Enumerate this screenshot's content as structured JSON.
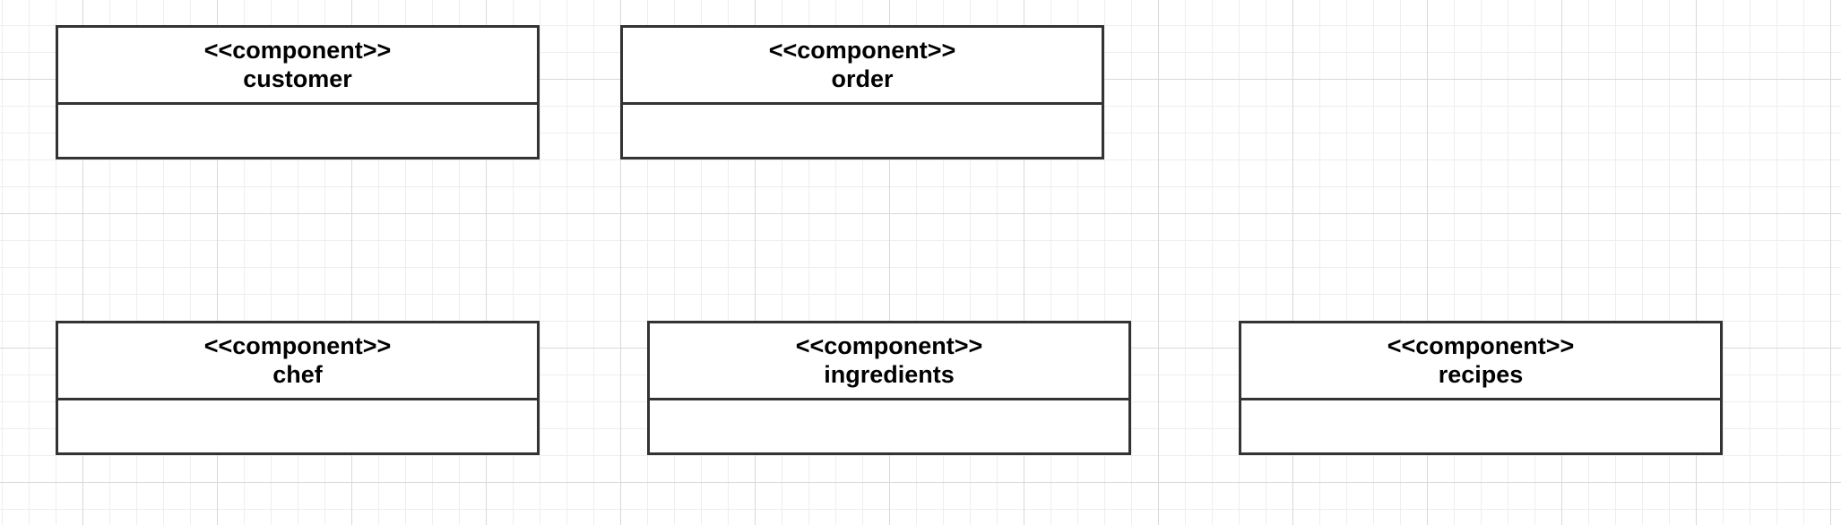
{
  "canvas": {
    "background": "#ffffff",
    "grid_major_color": "#d9d9d9",
    "grid_minor_color": "#eeeeee",
    "border_color": "#333333"
  },
  "components": [
    {
      "stereotype": "<<component>>",
      "name": "customer"
    },
    {
      "stereotype": "<<component>>",
      "name": "order"
    },
    {
      "stereotype": "<<component>>",
      "name": "chef"
    },
    {
      "stereotype": "<<component>>",
      "name": "ingredients"
    },
    {
      "stereotype": "<<component>>",
      "name": "recipes"
    }
  ]
}
